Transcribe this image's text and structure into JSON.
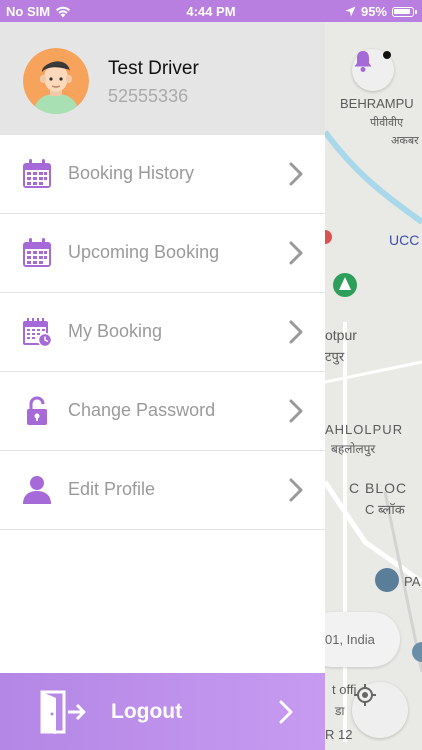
{
  "status_bar": {
    "carrier": "No SIM",
    "time": "4:44 PM",
    "battery": "95%"
  },
  "profile": {
    "name": "Test Driver",
    "phone": "52555336"
  },
  "menu": [
    {
      "label": "Booking History",
      "icon": "calendar-icon"
    },
    {
      "label": "Upcoming Booking",
      "icon": "calendar-icon"
    },
    {
      "label": "My Booking",
      "icon": "calendar-clock-icon"
    },
    {
      "label": "Change Password",
      "icon": "unlock-icon"
    },
    {
      "label": "Edit Profile",
      "icon": "user-icon"
    }
  ],
  "logout": {
    "label": "Logout",
    "icon": "exit-door-icon"
  },
  "map": {
    "labels": [
      "BEHRAMPU",
      "पीवीवीए",
      "अकबर",
      "UCC",
      "otpur",
      "टपुर",
      "AHLOLPUR",
      "बहलोलपुर",
      "C BLOC",
      "C ब्लॉक",
      "PA",
      "01, India",
      "t offi",
      "डा",
      "R 12"
    ]
  },
  "colors": {
    "accent": "#b97fe0",
    "icon_purple": "#a66ad8"
  }
}
